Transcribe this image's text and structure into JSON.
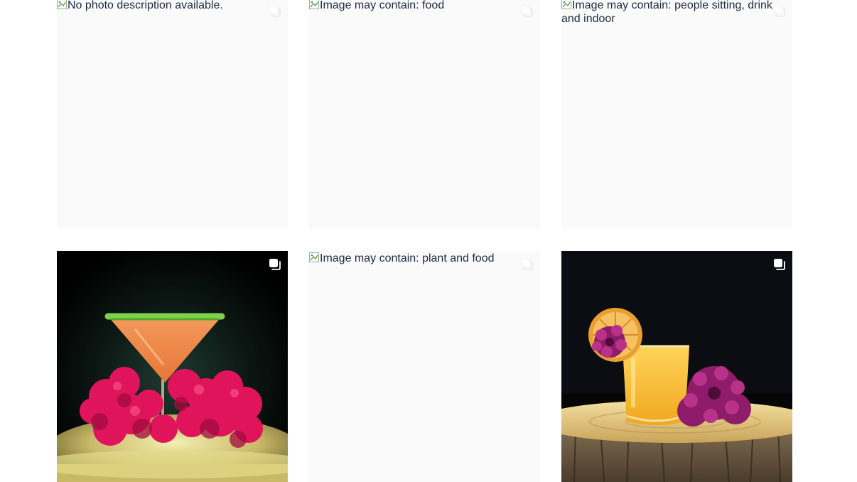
{
  "grid": {
    "posts": [
      {
        "alt": "No photo description available.",
        "has_image": false,
        "multi": true
      },
      {
        "alt": "Image may contain: food",
        "has_image": false,
        "multi": true
      },
      {
        "alt": "Image may contain: people sitting, drink and indoor",
        "has_image": false,
        "multi": true
      },
      {
        "alt": "",
        "has_image": true,
        "multi": true
      },
      {
        "alt": "Image may contain: plant and food",
        "has_image": false,
        "multi": true
      },
      {
        "alt": "",
        "has_image": true,
        "multi": true
      }
    ]
  },
  "icons": {
    "broken_image": "broken-image-icon",
    "carousel": "carousel-icon"
  },
  "colors": {
    "placeholder_bg": "#fafafa",
    "alt_text": "#1d2a45",
    "photo_bg": "#000000"
  }
}
